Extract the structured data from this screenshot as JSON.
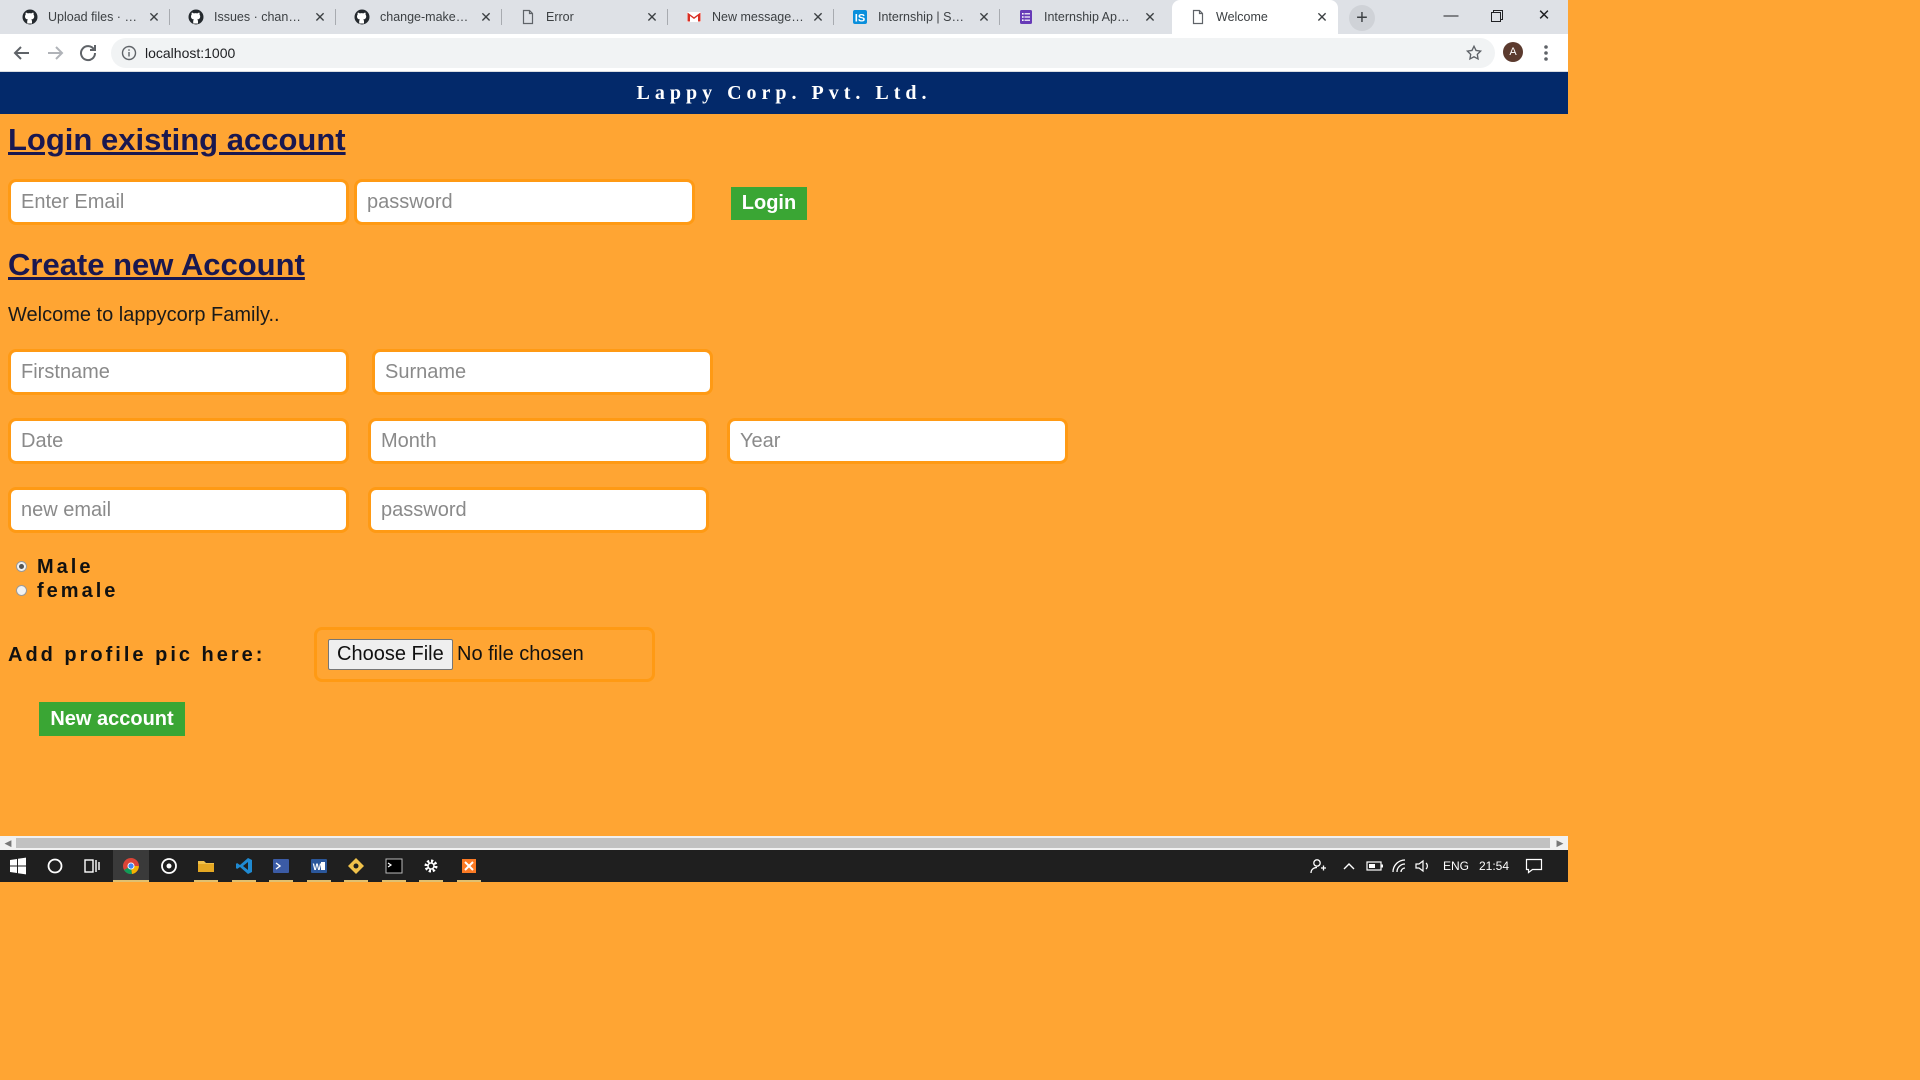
{
  "browser": {
    "tabs": [
      {
        "title": "Upload files · change-maker11",
        "favicon": "github-icon"
      },
      {
        "title": "Issues · change-maker11",
        "favicon": "github-icon"
      },
      {
        "title": "change-maker11/",
        "favicon": "github-icon"
      },
      {
        "title": "Error",
        "favicon": "page-icon"
      },
      {
        "title": "New message from",
        "favicon": "gmail-icon"
      },
      {
        "title": "Internship | Summer",
        "favicon": "internshala-icon"
      },
      {
        "title": "Internship Application",
        "favicon": "forms-icon"
      },
      {
        "title": "Welcome",
        "favicon": "page-icon",
        "active": true
      }
    ],
    "url": "localhost:1000",
    "profile_initial": "A"
  },
  "page": {
    "brand": "Lappy Corp. Pvt. Ltd.",
    "login": {
      "heading": "Login existing account",
      "email_placeholder": "Enter Email",
      "password_placeholder": "password",
      "button_label": "Login"
    },
    "signup": {
      "heading": "Create new Account",
      "welcome_text": "Welcome to lappycorp Family..",
      "firstname_placeholder": "Firstname",
      "surname_placeholder": "Surname",
      "date_placeholder": "Date",
      "month_placeholder": "Month",
      "year_placeholder": "Year",
      "email_placeholder": "new email",
      "password_placeholder": "password",
      "gender_options": [
        "Male",
        "female"
      ],
      "gender_selected": "Male",
      "profile_pic_label": "Add profile pic here:",
      "choose_file_label": "Choose File",
      "file_status": "No file chosen",
      "button_label": "New account"
    }
  },
  "taskbar": {
    "language": "ENG",
    "time": "21:54"
  },
  "colors": {
    "page_background": "#ffa533",
    "brand_bar": "#03296a",
    "field_border": "#ff9a14",
    "button_green": "#3aa634",
    "heading": "#1a1850"
  }
}
